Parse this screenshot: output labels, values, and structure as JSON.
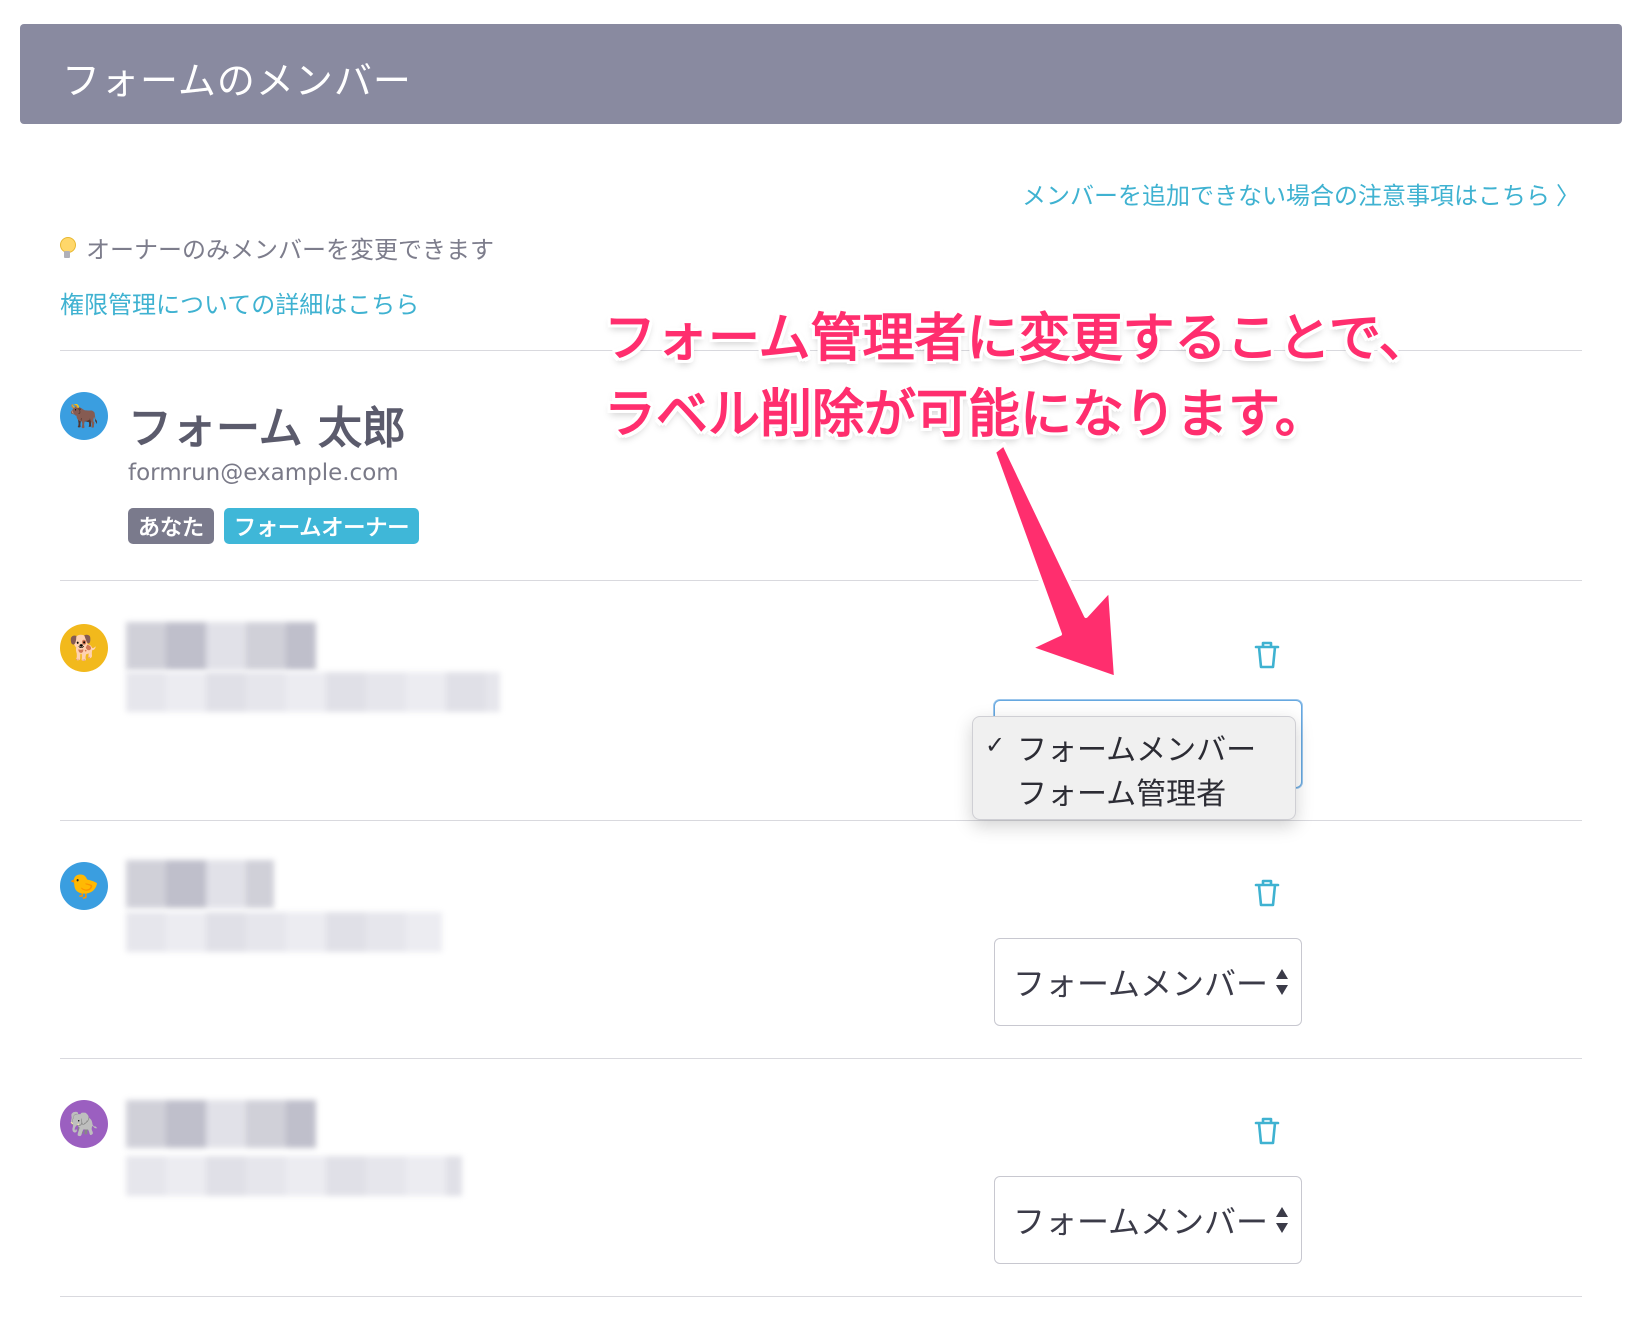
{
  "header": {
    "title": "フォームのメンバー"
  },
  "links": {
    "notice": "メンバーを追加できない場合の注意事項はこちら",
    "notice_chevron": "〉",
    "permissions": "権限管理についての詳細はこちら"
  },
  "owner_note": "オーナーのみメンバーを変更できます",
  "owner": {
    "avatar": "🐂",
    "name": "フォーム 太郎",
    "email": "formrun@example.com",
    "badges": [
      "あなた",
      "フォームオーナー"
    ]
  },
  "members": [
    {
      "avatar": "🐕",
      "role": "フォームメンバー"
    },
    {
      "avatar": "🐤",
      "role": "フォームメンバー"
    },
    {
      "avatar": "🐘",
      "role": "フォームメンバー"
    }
  ],
  "dropdown": {
    "check": "✓",
    "options": [
      "フォームメンバー",
      "フォーム管理者"
    ],
    "selected": "フォームメンバー"
  },
  "annotation": {
    "line1": "フォーム管理者に変更することで、",
    "line2": "ラベル削除が可能になります。"
  },
  "colors": {
    "header_bg": "#898aa0",
    "link": "#3fb2d1",
    "annotation": "#ff2e6e",
    "badge_owner": "#3fb7d8"
  }
}
